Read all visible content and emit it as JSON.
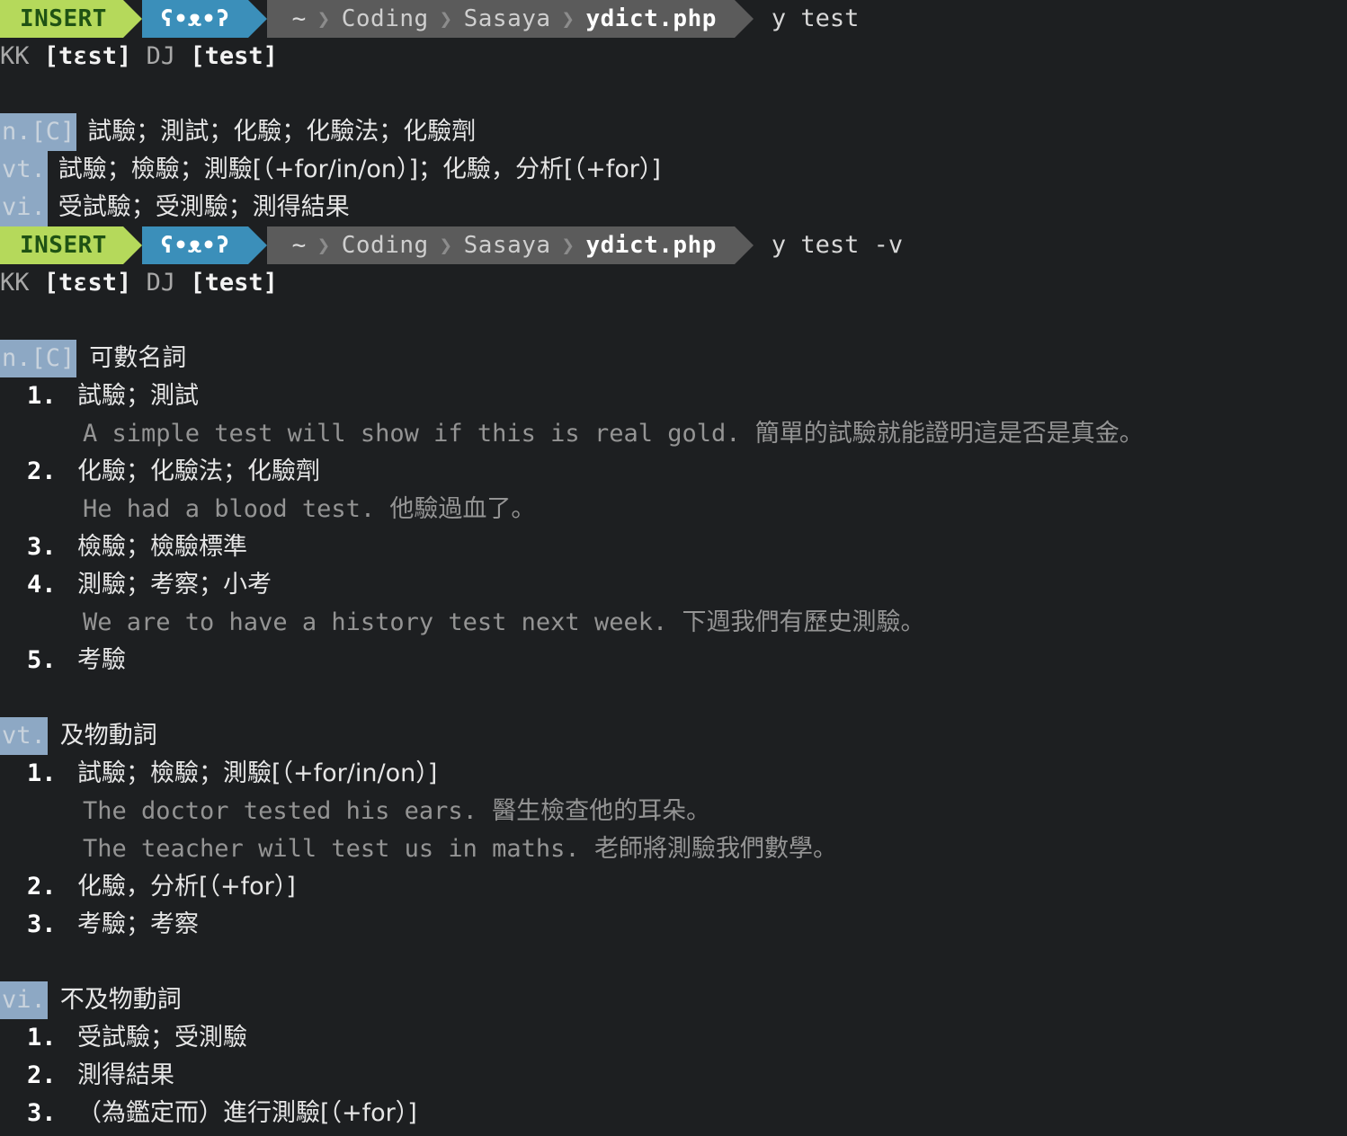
{
  "terminal": {
    "background": "#1d1f21",
    "foreground": "#d8d8d8"
  },
  "prompts": [
    {
      "mode": "INSERT",
      "branch": "ʕ•ᴥ•ʔ",
      "crumbs": [
        "~",
        "Coding",
        "Sasaya"
      ],
      "file": "ydict.php",
      "command": "y test",
      "colors": {
        "mode_bg": "#b5d95b",
        "mode_fg": "#1f5214",
        "branch_bg": "#3b8fba",
        "path_bg": "#5b5b5b"
      }
    },
    {
      "mode": "INSERT",
      "branch": "ʕ•ᴥ•ʔ",
      "crumbs": [
        "~",
        "Coding",
        "Sasaya"
      ],
      "file": "ydict.php",
      "command": "y test -v",
      "colors": {
        "mode_bg": "#b5d95b",
        "mode_fg": "#1f5214",
        "branch_bg": "#3b8fba",
        "path_bg": "#5b5b5b"
      }
    }
  ],
  "phonetics": {
    "kk_label": "KK",
    "kk_value": "[tɛst]",
    "dj_label": "DJ",
    "dj_value": "[test]"
  },
  "summary": {
    "rows": [
      {
        "tag": "n.[C]",
        "definitions": "試驗；測試；化驗；化驗法；化驗劑"
      },
      {
        "tag": "vt.",
        "definitions": "試驗；檢驗；測驗[（+for/in/on）]；化驗，分析[（+for）]"
      },
      {
        "tag": "vi.",
        "definitions": "受試驗；受測驗；測得結果"
      }
    ],
    "tag_bg": "#8da8c4"
  },
  "detail": {
    "sections": [
      {
        "tag": "n.[C]",
        "title": "可數名詞",
        "entries": [
          {
            "num": "1.",
            "def": "試驗；測試",
            "examples": [
              "A simple test will show if this is real gold. 簡單的試驗就能證明這是否是真金。"
            ]
          },
          {
            "num": "2.",
            "def": "化驗；化驗法；化驗劑",
            "examples": [
              "He had a blood test. 他驗過血了。"
            ]
          },
          {
            "num": "3.",
            "def": "檢驗；檢驗標準",
            "examples": []
          },
          {
            "num": "4.",
            "def": "測驗；考察；小考",
            "examples": [
              "We are to have a history test next week. 下週我們有歷史測驗。"
            ]
          },
          {
            "num": "5.",
            "def": "考驗",
            "examples": []
          }
        ]
      },
      {
        "tag": "vt.",
        "title": "及物動詞",
        "entries": [
          {
            "num": "1.",
            "def": "試驗；檢驗；測驗[（+for/in/on）]",
            "examples": [
              "The doctor tested his ears. 醫生檢查他的耳朵。",
              "The teacher will test us in maths. 老師將測驗我們數學。"
            ]
          },
          {
            "num": "2.",
            "def": "化驗，分析[（+for）]",
            "examples": []
          },
          {
            "num": "3.",
            "def": "考驗；考察",
            "examples": []
          }
        ]
      },
      {
        "tag": "vi.",
        "title": "不及物動詞",
        "entries": [
          {
            "num": "1.",
            "def": "受試驗；受測驗",
            "examples": []
          },
          {
            "num": "2.",
            "def": "測得結果",
            "examples": []
          },
          {
            "num": "3.",
            "def": "（為鑑定而）進行測驗[（+for）]",
            "examples": []
          }
        ]
      }
    ]
  },
  "icons": {
    "chevron_right": "❯",
    "arrow_right": "▶"
  }
}
